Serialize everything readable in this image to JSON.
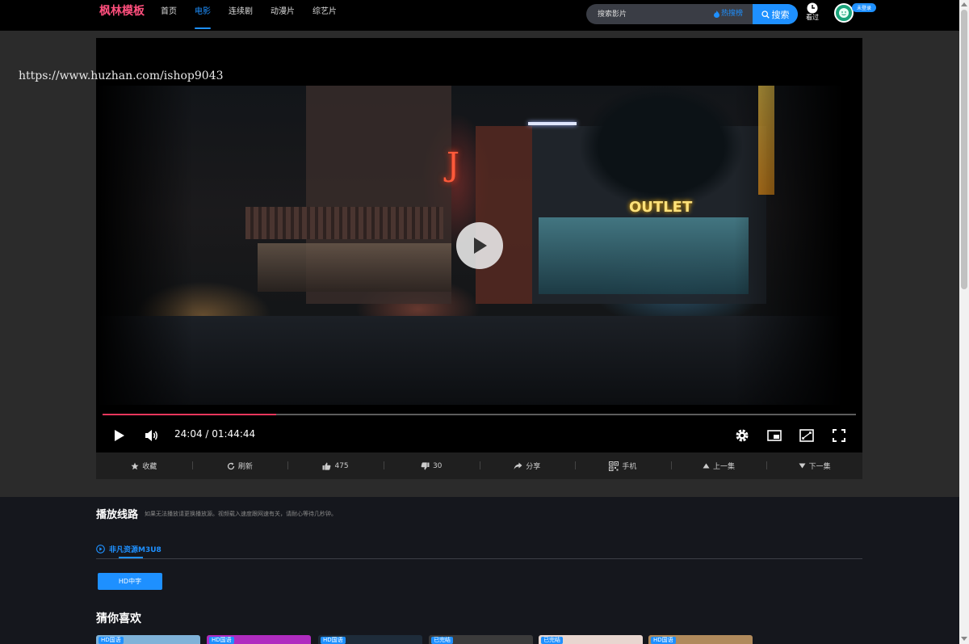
{
  "header": {
    "logo": "枫林模板",
    "nav": [
      {
        "label": "首页",
        "active": false
      },
      {
        "label": "电影",
        "active": true
      },
      {
        "label": "连续剧",
        "active": false
      },
      {
        "label": "动漫片",
        "active": false
      },
      {
        "label": "综艺片",
        "active": false
      }
    ],
    "search": {
      "placeholder": "搜索影片",
      "hot_label": "热搜榜",
      "button_label": "搜索"
    },
    "history_label": "看过",
    "login_badge": "未登录"
  },
  "watermark": "https://www.huzhan.com/ishop9043",
  "player": {
    "current_time": "24:04",
    "duration": "01:44:44",
    "time_display": "24:04 / 01:44:44",
    "progress_fraction": 0.23,
    "scene_sign": "OUTLET"
  },
  "actions": [
    {
      "label": "收藏",
      "icon": "star-icon"
    },
    {
      "label": "刷新",
      "icon": "refresh-icon"
    },
    {
      "label": "475",
      "icon": "thumbs-up-icon"
    },
    {
      "label": "30",
      "icon": "thumbs-down-icon"
    },
    {
      "label": "分享",
      "icon": "share-icon"
    },
    {
      "label": "手机",
      "icon": "qrcode-icon"
    },
    {
      "label": "上一集",
      "icon": "triangle-up-icon"
    },
    {
      "label": "下一集",
      "icon": "triangle-down-icon"
    }
  ],
  "lines": {
    "title": "播放线路",
    "hint": "如果无法播放请更换播放源。视频载入速度跟网速有关，请耐心等待几秒钟。",
    "source_tab": "非凡资源M3U8",
    "episode_button": "HD中字"
  },
  "recommend": {
    "title": "猜你喜欢",
    "cards": [
      {
        "badge": "HD国语",
        "color": "#7fb2d8"
      },
      {
        "badge": "HD国语",
        "color": "#b02cc0"
      },
      {
        "badge": "HD国语",
        "color": "#1e2c3a"
      },
      {
        "badge": "已完结",
        "color": "#3b3b3b"
      },
      {
        "badge": "已完结",
        "color": "#e8d6d0"
      },
      {
        "badge": "HD国语",
        "color": "#b08a5c"
      }
    ]
  },
  "colors": {
    "accent": "#1e90ff",
    "logo": "#ff4f7d",
    "progress": "#e8365c"
  }
}
